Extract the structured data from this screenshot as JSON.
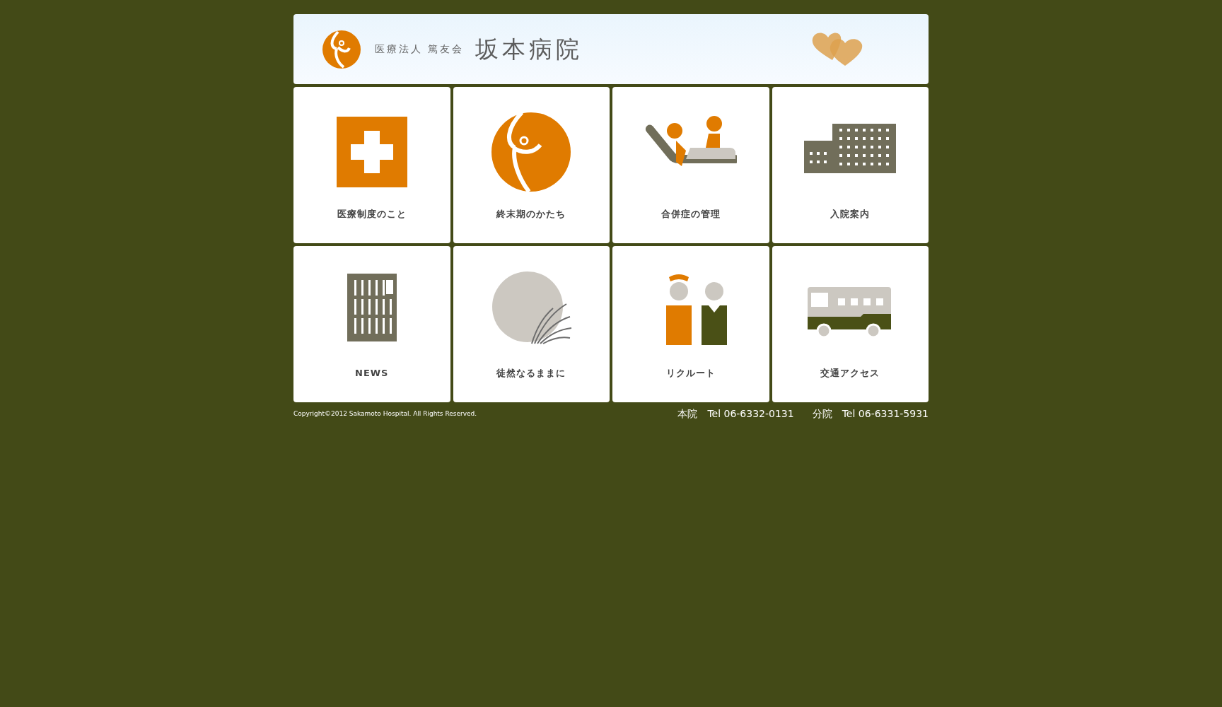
{
  "header": {
    "org": "医療法人 篤友会",
    "name": "坂本病院"
  },
  "tiles": [
    {
      "label": "医療制度のこと"
    },
    {
      "label": "終末期のかたち"
    },
    {
      "label": "合併症の管理"
    },
    {
      "label": "入院案内"
    },
    {
      "label": "NEWS"
    },
    {
      "label": "徒然なるままに"
    },
    {
      "label": "リクルート"
    },
    {
      "label": "交通アクセス"
    }
  ],
  "footer": {
    "copyright": "Copyright©2012 Sakamoto Hospital. All Rights Reserved.",
    "contacts": [
      {
        "place": "本院",
        "tel": "Tel 06-6332-0131"
      },
      {
        "place": "分院",
        "tel": "Tel 06-6331-5931"
      }
    ]
  }
}
